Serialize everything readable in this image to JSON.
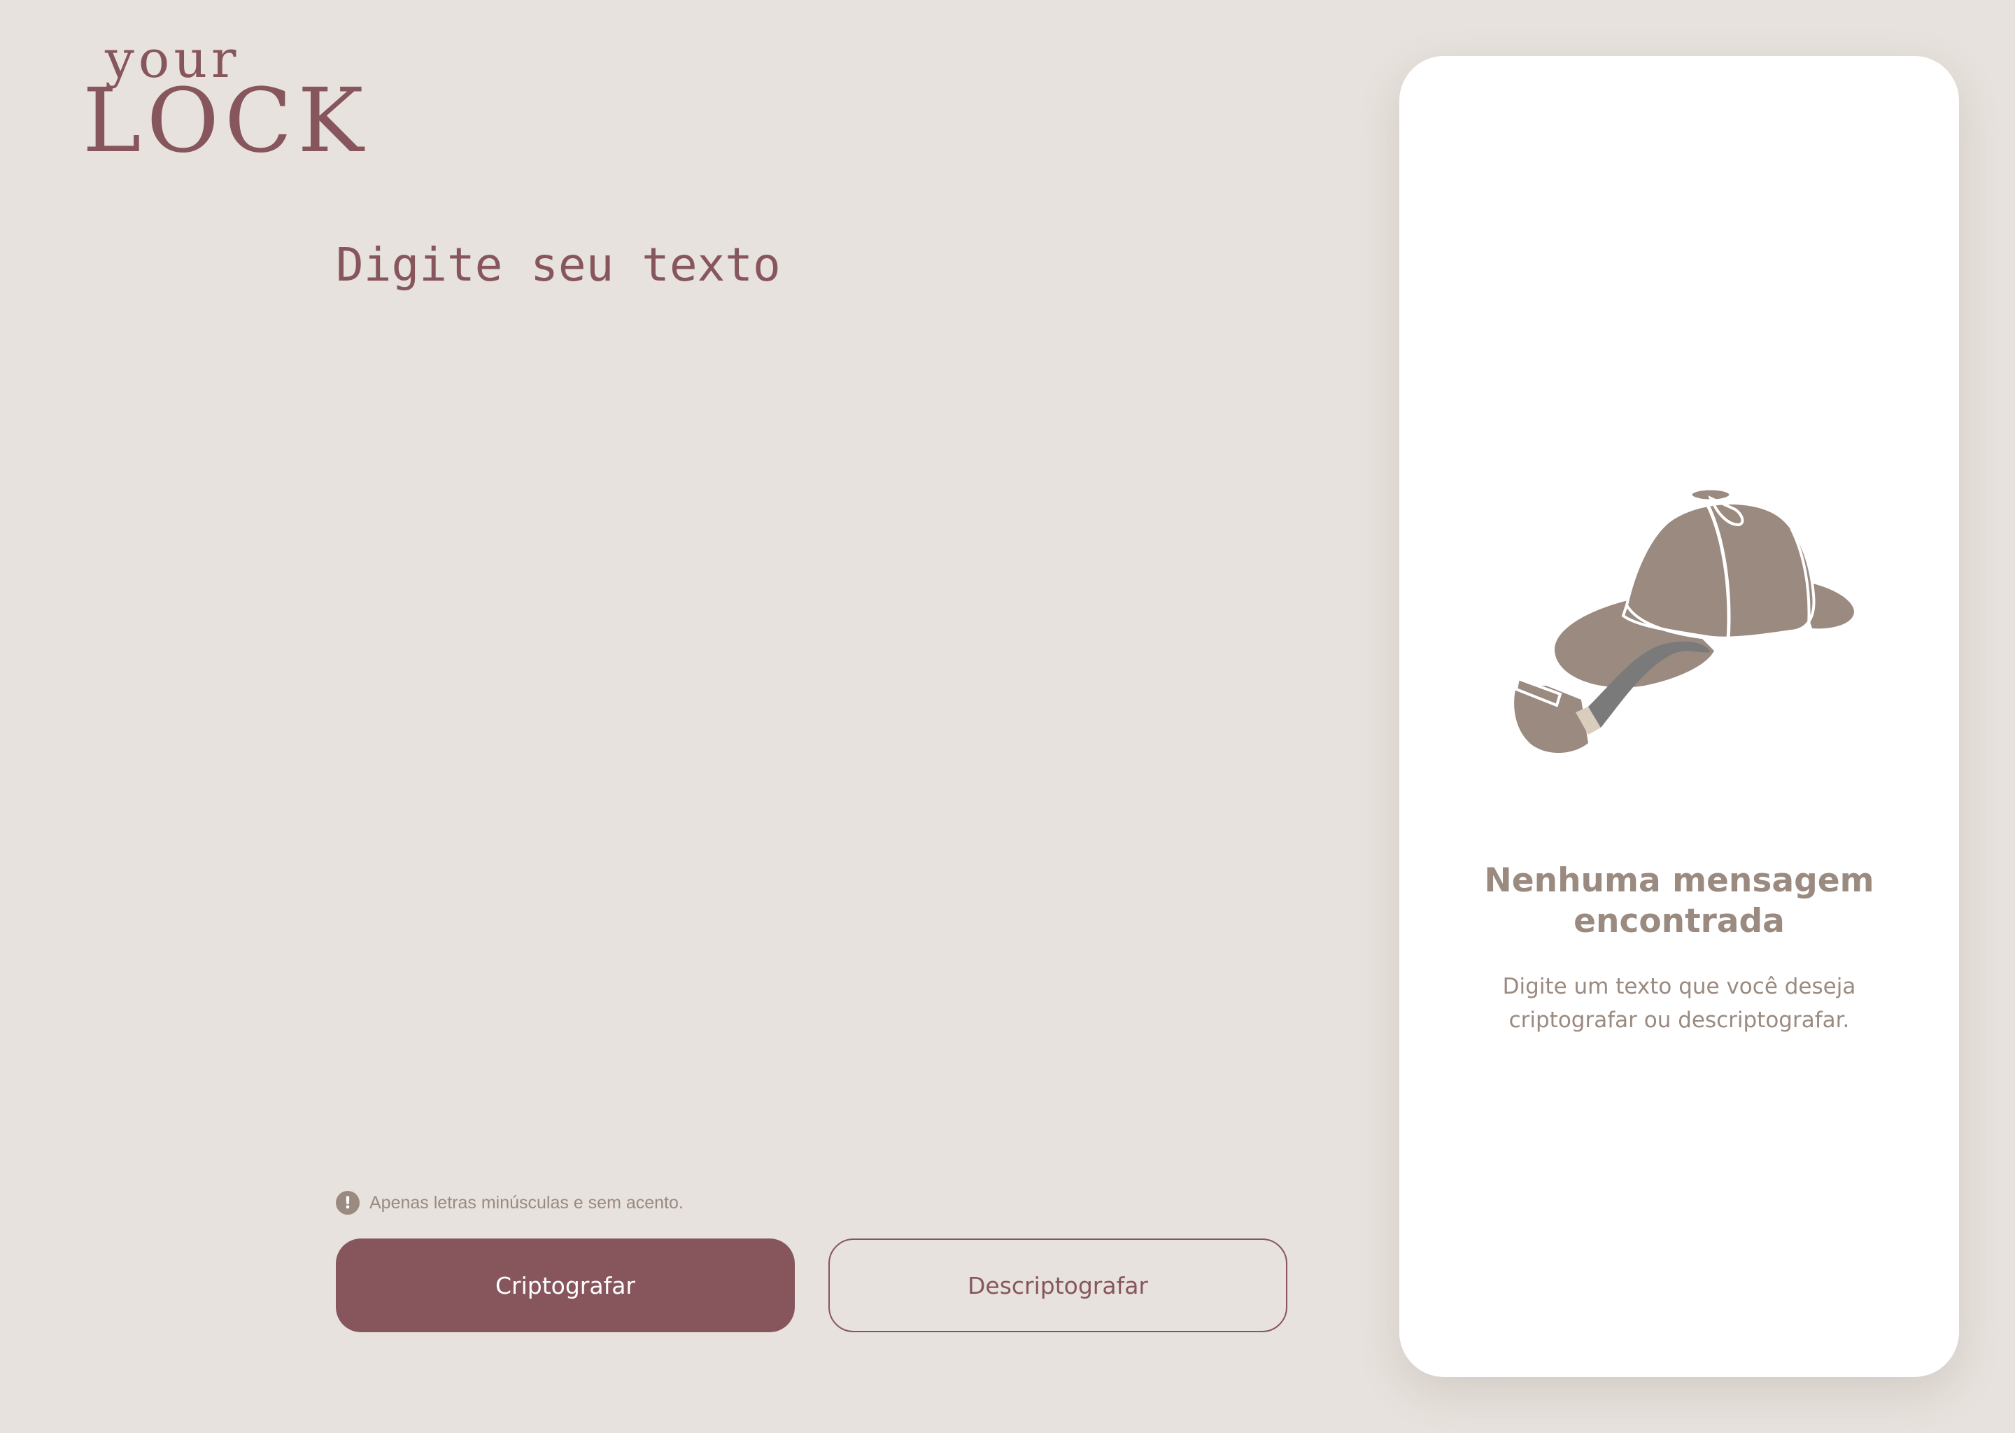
{
  "logo": {
    "top": "your",
    "bottom": "LOCK"
  },
  "input": {
    "placeholder": "Digite seu texto",
    "value": ""
  },
  "hint": {
    "icon": "exclamation-icon",
    "text": "Apenas letras minúsculas e sem acento."
  },
  "buttons": {
    "encrypt_label": "Criptografar",
    "decrypt_label": "Descriptografar"
  },
  "output": {
    "illustration": "detective-hat-and-pipe",
    "title": "Nenhuma mensagem\nencontrada",
    "description": "Digite um texto que você deseja criptografar ou descriptografar."
  },
  "colors": {
    "background": "#E7E2DD",
    "primary": "#87565D",
    "muted": "#9A8A80",
    "card": "#FFFFFF"
  }
}
